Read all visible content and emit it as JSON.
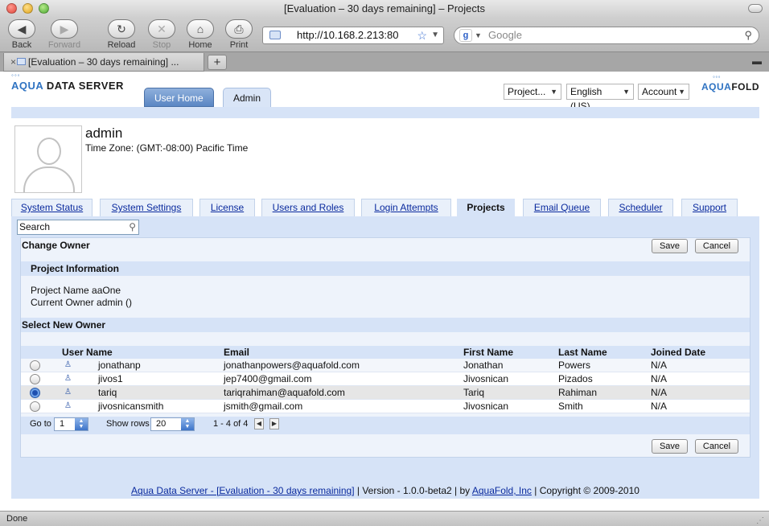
{
  "window": {
    "title": "[Evaluation – 30 days remaining] – Projects"
  },
  "toolbar": {
    "back": "Back",
    "forward": "Forward",
    "reload": "Reload",
    "stop": "Stop",
    "home": "Home",
    "print": "Print",
    "url": "http://10.168.2.213:80",
    "search_placeholder": "Google"
  },
  "tabs": {
    "current": "[Evaluation – 30 days remaining] ...",
    "new_tab": "+"
  },
  "header": {
    "logo_left_aqua": "AQUA",
    "logo_left_rest": " DATA SERVER",
    "logo_right_aqua": "AQUA",
    "logo_right_fold": "FOLD",
    "app_tabs": [
      "User Home",
      "Admin"
    ],
    "project_dropdown": "Project...",
    "language_dropdown": "English (US)",
    "account_dropdown": "Account"
  },
  "user": {
    "name": "admin",
    "timezone": "Time Zone: (GMT:-08:00) Pacific Time"
  },
  "admin_tabs": [
    "System Status",
    "System Settings",
    "License",
    "Users and Roles",
    "Login Attempts",
    "Projects",
    "Email Queue",
    "Scheduler",
    "Support"
  ],
  "active_admin_tab": "Projects",
  "search": {
    "value": "Search"
  },
  "change_owner": {
    "title": "Change Owner",
    "save": "Save",
    "cancel": "Cancel",
    "project_info_title": "Project Information",
    "project_name": "Project Name aaOne",
    "current_owner": "Current Owner admin ()",
    "select_new_owner": "Select New Owner"
  },
  "grid": {
    "columns": [
      "User Name",
      "Email",
      "First Name",
      "Last Name",
      "Joined Date"
    ],
    "rows": [
      {
        "user": "jonathanp",
        "email": "jonathanpowers@aquafold.com",
        "first": "Jonathan",
        "last": "Powers",
        "joined": "N/A",
        "selected": false
      },
      {
        "user": "jivos1",
        "email": "jep7400@gmail.com",
        "first": "Jivosnican",
        "last": "Pizados",
        "joined": "N/A",
        "selected": false
      },
      {
        "user": "tariq",
        "email": "tariqrahiman@aquafold.com",
        "first": "Tariq",
        "last": "Rahiman",
        "joined": "N/A",
        "selected": true
      },
      {
        "user": "jivosnicansmith",
        "email": "jsmith@gmail.com",
        "first": "Jivosnican",
        "last": "Smith",
        "joined": "N/A",
        "selected": false
      }
    ],
    "goto_label": "Go to",
    "goto_value": "1",
    "show_rows_label": "Show rows",
    "show_rows_value": "20",
    "range": "1 - 4 of 4"
  },
  "footer": {
    "link1": "Aqua Data Server - [Evaluation - 30 days remaining]",
    "version": " | Version - 1.0.0-beta2 | by ",
    "link2": "AquaFold, Inc",
    "copyright": " | Copyright © 2009-2010"
  },
  "status": {
    "text": "Done"
  }
}
